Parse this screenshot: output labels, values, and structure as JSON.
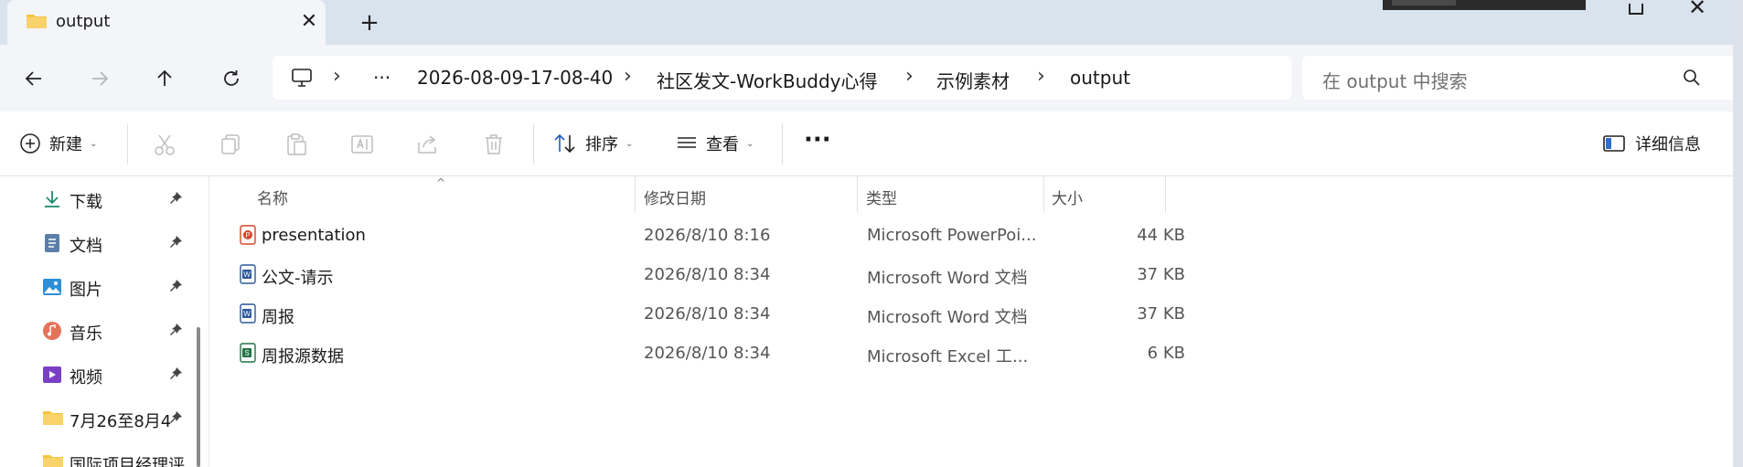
{
  "tab": {
    "title": "output"
  },
  "breadcrumb": {
    "items": [
      "2026-08-09-17-08-40",
      "社区发文-WorkBuddy心得",
      "示例素材",
      "output"
    ],
    "overflow": "···"
  },
  "search": {
    "placeholder": "在 output 中搜索"
  },
  "commands": {
    "new_label": "新建",
    "sort_label": "排序",
    "view_label": "查看",
    "more_label": "···",
    "details_label": "详细信息"
  },
  "sidebar": {
    "items": [
      {
        "label": "下载",
        "icon": "download-icon"
      },
      {
        "label": "文档",
        "icon": "documents-icon"
      },
      {
        "label": "图片",
        "icon": "pictures-icon"
      },
      {
        "label": "音乐",
        "icon": "music-icon"
      },
      {
        "label": "视频",
        "icon": "videos-icon"
      },
      {
        "label": "7月26至8月4",
        "icon": "folder-icon"
      },
      {
        "label": "国际项目经理评",
        "icon": "folder-icon"
      }
    ]
  },
  "columns": {
    "name": "名称",
    "date": "修改日期",
    "type": "类型",
    "size": "大小"
  },
  "files": [
    {
      "name": "presentation",
      "date": "2026/8/10 8:16",
      "type": "Microsoft PowerPoi...",
      "size": "44 KB",
      "icon": "powerpoint-icon"
    },
    {
      "name": "公文-请示",
      "date": "2026/8/10 8:34",
      "type": "Microsoft Word 文档",
      "size": "37 KB",
      "icon": "word-icon"
    },
    {
      "name": "周报",
      "date": "2026/8/10 8:34",
      "type": "Microsoft Word 文档",
      "size": "37 KB",
      "icon": "word-icon"
    },
    {
      "name": "周报源数据",
      "date": "2026/8/10 8:34",
      "type": "Microsoft Excel 工...",
      "size": "6 KB",
      "icon": "excel-icon"
    }
  ],
  "colors": {
    "tabstrip_bg": "#d9e3ee",
    "toolbar_bg": "#f3f5f9",
    "folder_yellow": "#f4c542",
    "accent_blue": "#2f6fd1",
    "ppt_orange": "#d24726",
    "word_blue": "#2b579a",
    "excel_green": "#217346"
  }
}
